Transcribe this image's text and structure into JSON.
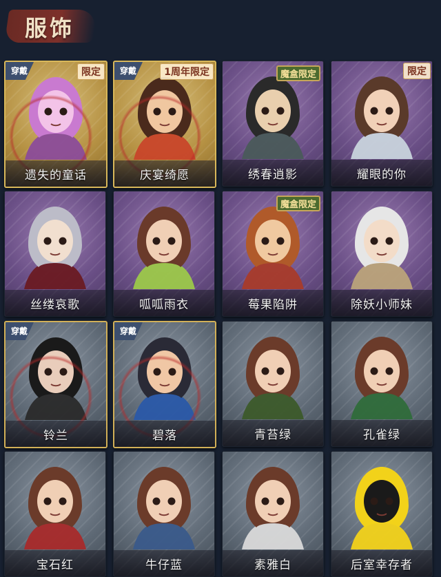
{
  "section": {
    "title": "服饰"
  },
  "cards": [
    {
      "name": "遗失的童话",
      "bg": "gold",
      "wear_label": "穿戴",
      "limit_label": "限定",
      "portrait_colors": [
        "#c97ad0",
        "#f3c3e8",
        "#8b4c9a"
      ]
    },
    {
      "name": "庆宴绮愿",
      "bg": "gold",
      "wear_label": "穿戴",
      "limit_label": "1周年限定",
      "portrait_colors": [
        "#4a2a1c",
        "#f0c7a0",
        "#c8462a"
      ]
    },
    {
      "name": "绣春逍影",
      "bg": "purple",
      "limit_label": "魔盒限定",
      "portrait_colors": [
        "#2a2a2a",
        "#e9cfae",
        "#4a5a5a"
      ]
    },
    {
      "name": "耀眼的你",
      "bg": "purple",
      "limit_label": "限定",
      "portrait_colors": [
        "#5a3a2a",
        "#f1d1b8",
        "#c8d3dc"
      ]
    },
    {
      "name": "丝缕哀歌",
      "bg": "purple",
      "portrait_colors": [
        "#bcbcc8",
        "#f1dfcf",
        "#6a1a22"
      ]
    },
    {
      "name": "呱呱雨衣",
      "bg": "purple",
      "portrait_colors": [
        "#6a3a2a",
        "#f0cfb5",
        "#9cc84a"
      ]
    },
    {
      "name": "莓果陷阱",
      "bg": "purple",
      "limit_label": "魔盒限定",
      "portrait_colors": [
        "#b05a2a",
        "#f0c9a0",
        "#a83b2a"
      ]
    },
    {
      "name": "除妖小师妹",
      "bg": "purple",
      "portrait_colors": [
        "#e6e6e6",
        "#f3dcc8",
        "#bba37a"
      ]
    },
    {
      "name": "铃兰",
      "bg": "gold-gray",
      "wear_label": "穿戴",
      "portrait_colors": [
        "#1a1a1a",
        "#e9cdbb",
        "#2a2a2a"
      ]
    },
    {
      "name": "碧落",
      "bg": "gold-gray",
      "wear_label": "穿戴",
      "portrait_colors": [
        "#2a2a36",
        "#f0c7a5",
        "#2a58a8"
      ]
    },
    {
      "name": "青苔绿",
      "bg": "gray",
      "portrait_colors": [
        "#6b3b2a",
        "#f0cfb5",
        "#3c5a2a"
      ]
    },
    {
      "name": "孔雀绿",
      "bg": "gray",
      "portrait_colors": [
        "#6b3b2a",
        "#f0cfb5",
        "#2f6b3a"
      ]
    },
    {
      "name": "宝石红",
      "bg": "gray",
      "portrait_colors": [
        "#6b3b2a",
        "#f0cfb5",
        "#a82a2a"
      ]
    },
    {
      "name": "牛仔蓝",
      "bg": "gray",
      "portrait_colors": [
        "#6b3b2a",
        "#f0cfb5",
        "#3a5a8a"
      ]
    },
    {
      "name": "素雅白",
      "bg": "gray",
      "portrait_colors": [
        "#6b3b2a",
        "#f0cfb5",
        "#d9d9d9"
      ]
    },
    {
      "name": "后室幸存者",
      "bg": "gray",
      "portrait_colors": [
        "#f2d21a",
        "#1a1a1a",
        "#f2d21a"
      ]
    }
  ]
}
